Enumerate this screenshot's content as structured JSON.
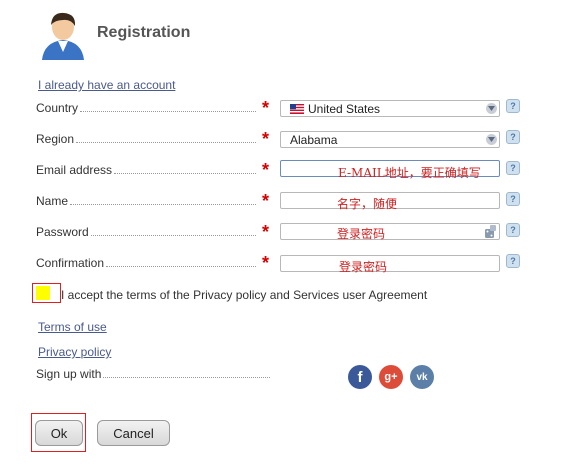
{
  "header": {
    "title": "Registration"
  },
  "links": {
    "have_account": "I already have an account",
    "terms": "Terms of use",
    "privacy": "Privacy policy"
  },
  "form": {
    "country": {
      "label": "Country",
      "value": "United States"
    },
    "region": {
      "label": "Region",
      "value": "Alabama"
    },
    "email": {
      "label": "Email address",
      "hint": "E-MAIL地址，要正确填写"
    },
    "name": {
      "label": "Name",
      "hint": "名字，随便"
    },
    "password": {
      "label": "Password",
      "hint": "登录密码"
    },
    "confirmation": {
      "label": "Confirmation",
      "hint": "登录密码"
    },
    "required_mark": "*",
    "help_mark": "?"
  },
  "accept_text": "I accept the terms of the Privacy policy and Services user Agreement",
  "signup": {
    "label": "Sign up with",
    "facebook_glyph": "f",
    "google_glyph": "g+",
    "vk_glyph": "vk"
  },
  "buttons": {
    "ok": "Ok",
    "cancel": "Cancel"
  },
  "colors": {
    "required": "#d60000",
    "annotation": "#e02020",
    "facebook": "#3b5998",
    "google": "#dd4b39",
    "vk": "#5b7fa6"
  }
}
